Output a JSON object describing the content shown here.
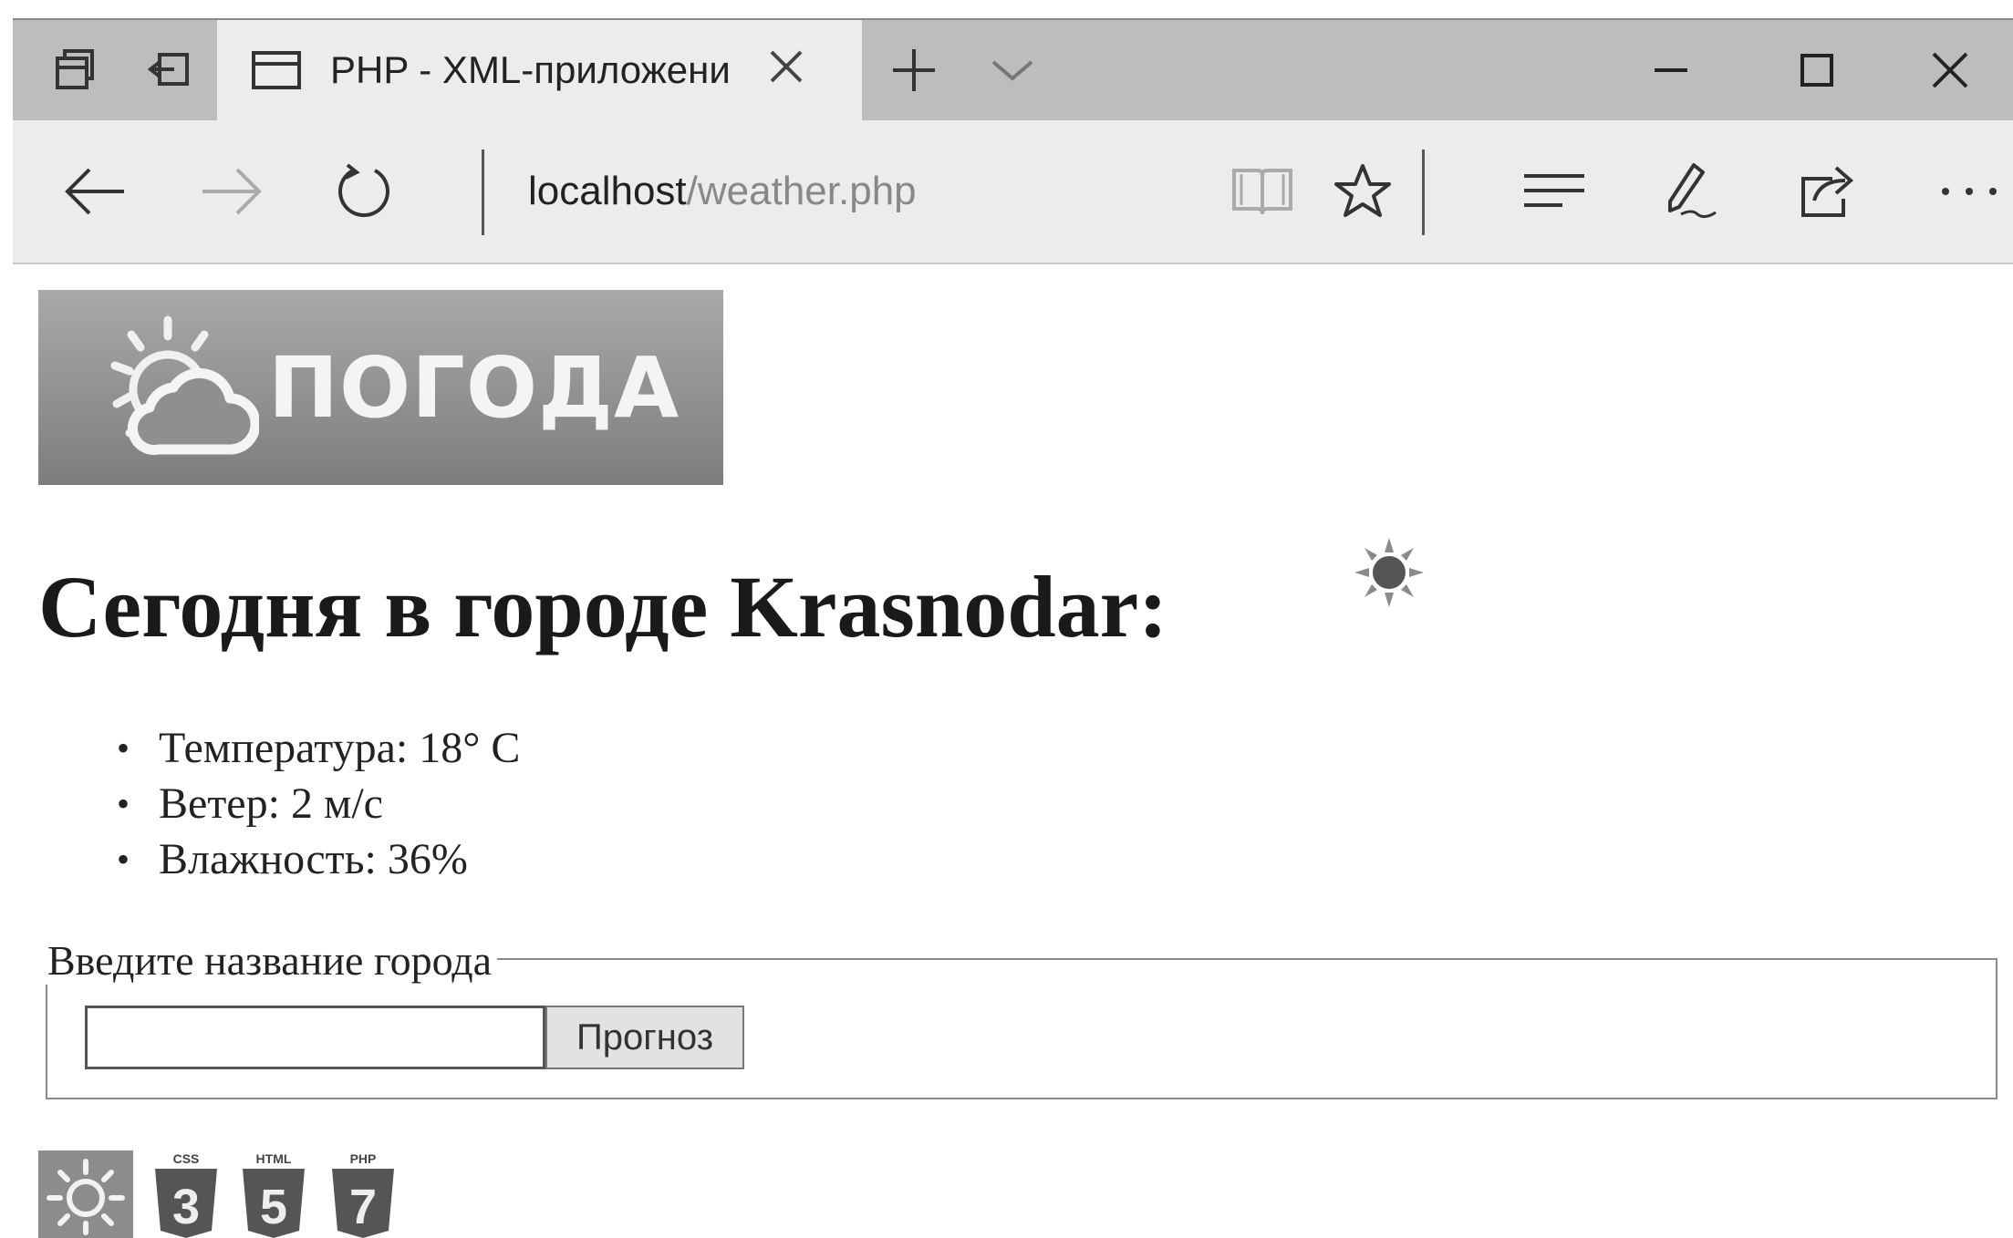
{
  "browser": {
    "tab_title": "PHP - XML-приложени",
    "address_host": "localhost",
    "address_path": "/weather.php"
  },
  "page": {
    "logo_text": "ПОГОДА",
    "heading": "Сегодня в городе Krasnodar:",
    "weather_icon": "sun-icon",
    "details": [
      "Температура: 18° С",
      "Ветер: 2 м/с",
      "Влажность: 36%"
    ],
    "form": {
      "legend": "Введите название города",
      "input_value": "",
      "button_label": "Прогноз"
    },
    "footer_badges": {
      "css_label": "CSS",
      "css_number": "3",
      "html_label": "HTML",
      "html_number": "5",
      "php_label": "PHP",
      "php_number": "7"
    }
  },
  "colors": {
    "titlebar": "#bdbdbd",
    "toolbar": "#ececec",
    "logo_bg": "#8f8f8f"
  }
}
